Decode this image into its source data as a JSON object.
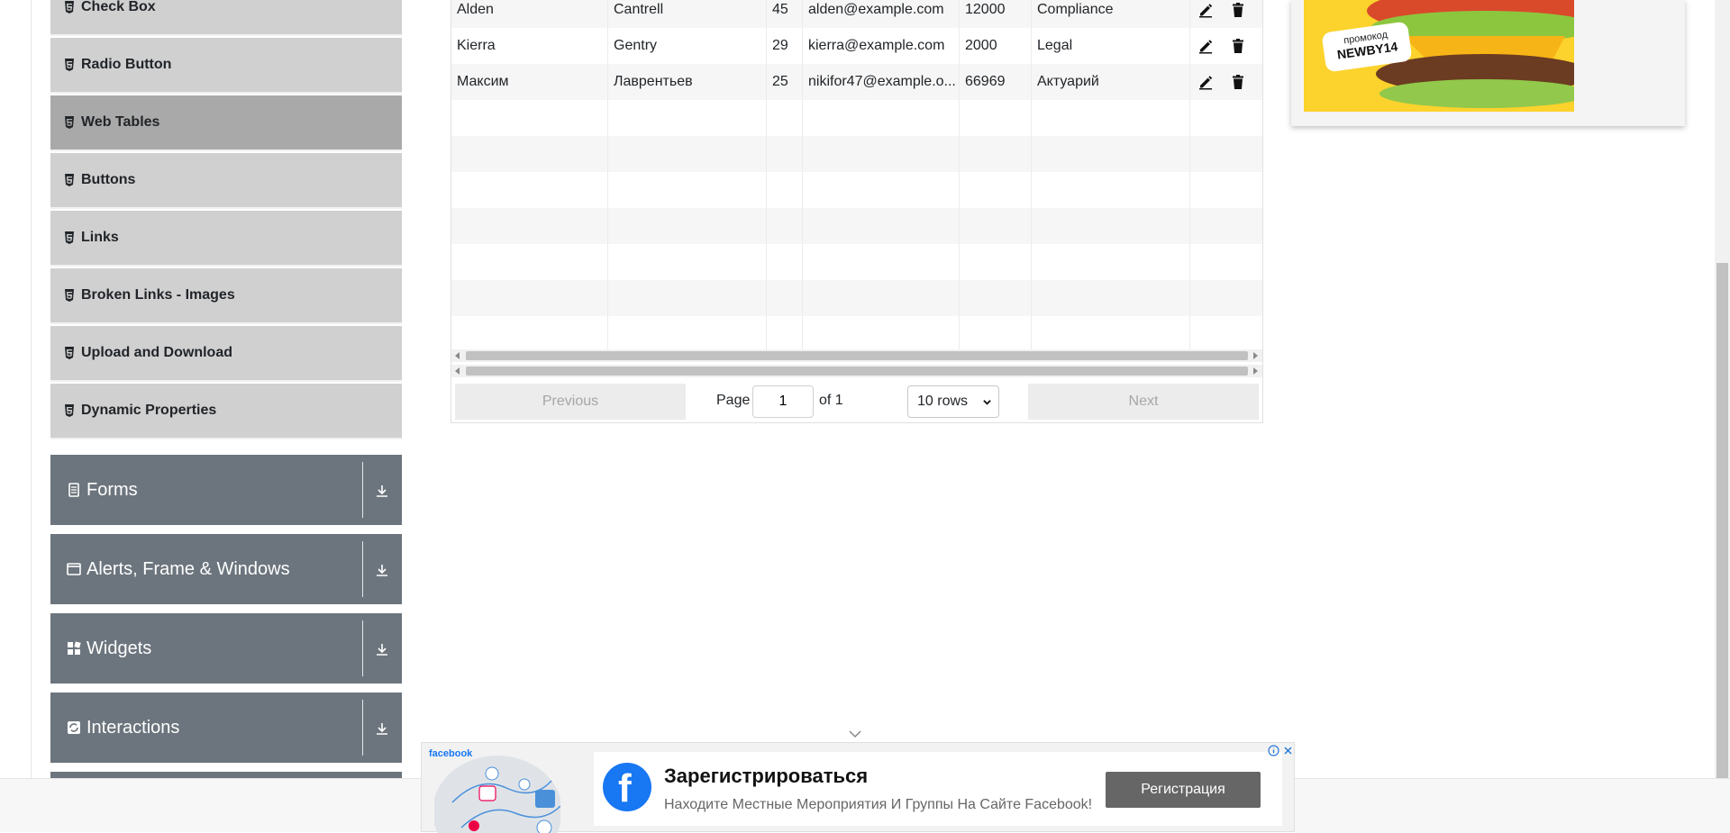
{
  "sidebar": {
    "elements_items": [
      {
        "label": "Check Box",
        "active": false
      },
      {
        "label": "Radio Button",
        "active": false
      },
      {
        "label": "Web Tables",
        "active": true
      },
      {
        "label": "Buttons",
        "active": false
      },
      {
        "label": "Links",
        "active": false
      },
      {
        "label": "Broken Links - Images",
        "active": false
      },
      {
        "label": "Upload and Download",
        "active": false
      },
      {
        "label": "Dynamic Properties",
        "active": false
      }
    ],
    "groups": [
      {
        "label": "Forms",
        "icon": "document-icon"
      },
      {
        "label": "Alerts, Frame & Windows",
        "icon": "window-icon"
      },
      {
        "label": "Widgets",
        "icon": "widgets-icon"
      },
      {
        "label": "Interactions",
        "icon": "interactions-icon"
      }
    ]
  },
  "table": {
    "rows": [
      {
        "first_name": "Alden",
        "last_name": "Cantrell",
        "age": "45",
        "email": "alden@example.com",
        "salary": "12000",
        "department": "Compliance"
      },
      {
        "first_name": "Kierra",
        "last_name": "Gentry",
        "age": "29",
        "email": "kierra@example.com",
        "salary": "2000",
        "department": "Legal"
      },
      {
        "first_name": "Максим",
        "last_name": "Лаврентьев",
        "age": "25",
        "email": "nikifor47@example.o...",
        "salary": "66969",
        "department": "Актуарий"
      }
    ],
    "empty_rows": 7
  },
  "pagination": {
    "previous_label": "Previous",
    "next_label": "Next",
    "page_label": "Page",
    "page_value": "1",
    "of_label": "of 1",
    "rows_selected": "10 rows"
  },
  "side_ad": {
    "promo_line1": "промокод",
    "promo_line2": "NEWBY14"
  },
  "bottom_ad": {
    "brand_small": "facebook",
    "title": "Зарегистрироваться",
    "subtitle": "Находите Местные Мероприятия И Группы На Сайте Facebook!",
    "button_label": "Регистрация"
  },
  "colors": {
    "menu_item_bg": "#d0d0d0",
    "menu_item_active_bg": "#a9a9a9",
    "group_header_bg": "#6c757d",
    "facebook_blue": "#1877f2"
  }
}
